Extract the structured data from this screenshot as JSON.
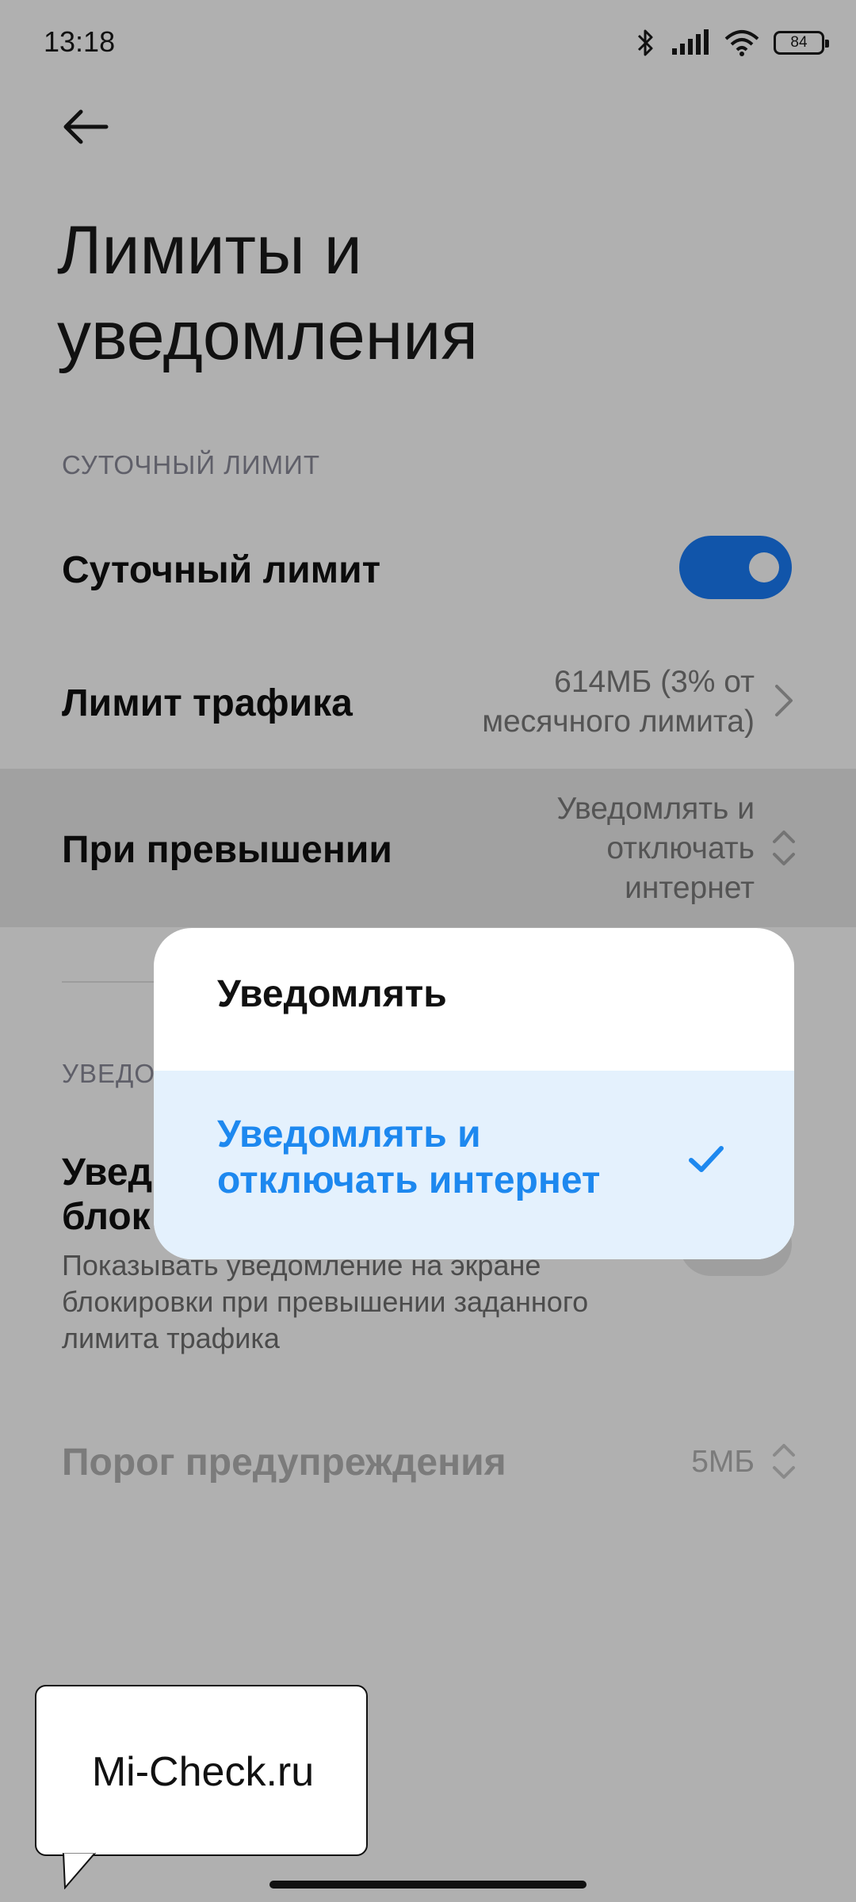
{
  "status_bar": {
    "time": "13:18",
    "battery": "84",
    "icons": [
      "bluetooth-icon",
      "signal-icon",
      "wifi-icon",
      "battery-icon"
    ]
  },
  "header": {
    "title": "Лимиты и уведомления"
  },
  "sections": {
    "daily_limit": {
      "label": "СУТОЧНЫЙ ЛИМИТ",
      "toggle_title": "Суточный лимит",
      "toggle_on": true,
      "traffic_title": "Лимит трафика",
      "traffic_value": "614МБ (3% от месячного лимита)",
      "exceed_title": "При превышении",
      "exceed_value": "Уведомлять и отключать интернет"
    },
    "notifications": {
      "label_partial": "УВЕДО",
      "lock_title_partial_1": "Увед",
      "lock_title_partial_2": "блок",
      "lock_subtitle": "Показывать уведомление на экране блокировки при превышении заданного лимита трафика",
      "lock_toggle_on": false,
      "threshold_title": "Порог предупреждения",
      "threshold_value": "5МБ"
    }
  },
  "popup": {
    "options": [
      {
        "label": "Уведомлять",
        "selected": false
      },
      {
        "label": "Уведомлять и отключать интернет",
        "selected": true
      }
    ]
  },
  "watermark": {
    "text": "Mi-Check.ru"
  },
  "colors": {
    "accent": "#1d88ef",
    "toggle_on": "#1a7cf6",
    "selected_bg": "#e4f1fd",
    "overlay": "rgba(0,0,0,0.31)"
  }
}
